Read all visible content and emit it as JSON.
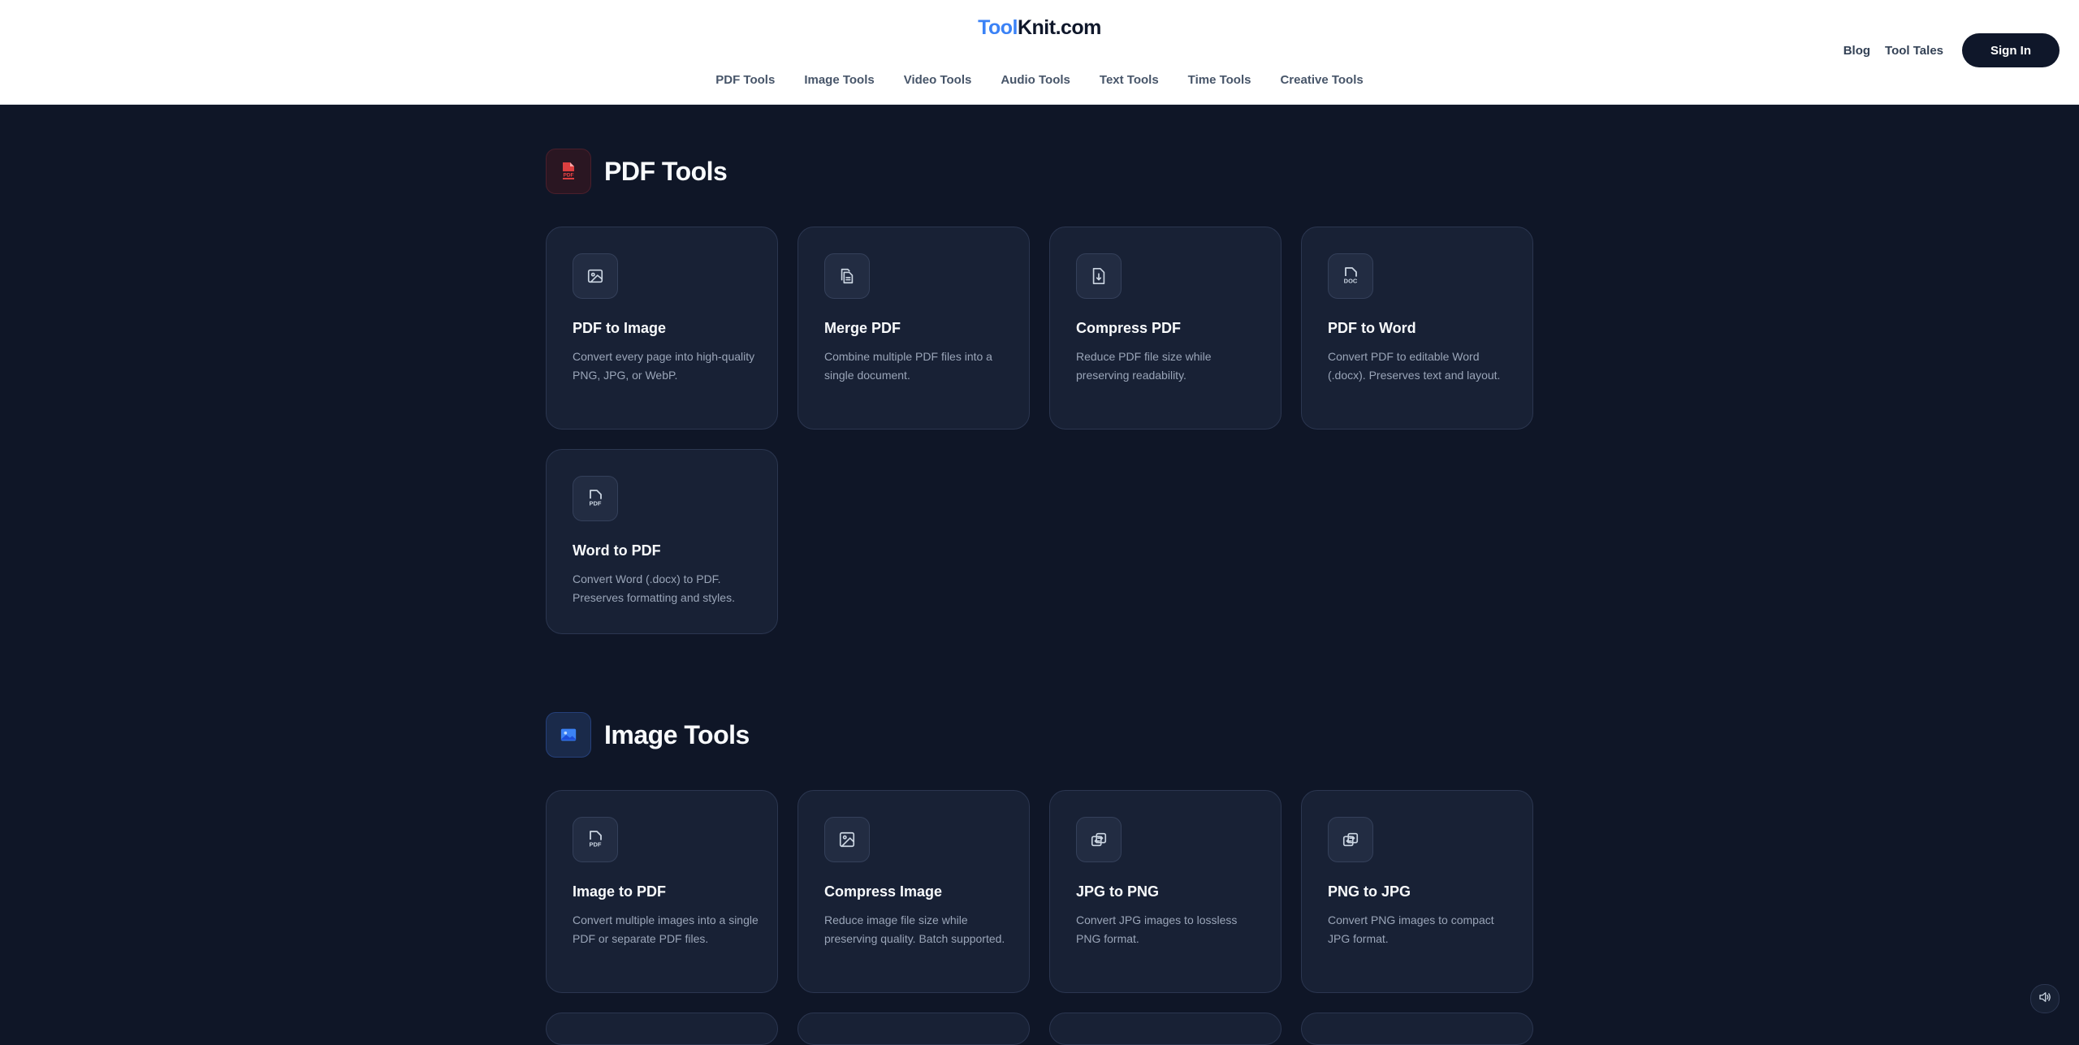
{
  "header": {
    "logo_part1": "Tool",
    "logo_part2": "Knit.com",
    "nav": [
      "PDF Tools",
      "Image Tools",
      "Video Tools",
      "Audio Tools",
      "Text Tools",
      "Time Tools",
      "Creative Tools"
    ],
    "blog": "Blog",
    "tool_tales": "Tool Tales",
    "sign_in": "Sign In"
  },
  "sections": [
    {
      "title": "PDF Tools",
      "icon": "pdf-file-icon",
      "accent": "#ef4444",
      "tools": [
        {
          "title": "PDF to Image",
          "desc": "Convert every page into high-quality PNG, JPG, or WebP.",
          "icon": "image-icon"
        },
        {
          "title": "Merge PDF",
          "desc": "Combine multiple PDF files into a single document.",
          "icon": "files-icon"
        },
        {
          "title": "Compress PDF",
          "desc": "Reduce PDF file size while preserving readability.",
          "icon": "compress-file-icon"
        },
        {
          "title": "PDF to Word",
          "desc": "Convert PDF to editable Word (.docx). Preserves text and layout.",
          "icon": "doc-file-icon"
        },
        {
          "title": "Word to PDF",
          "desc": "Convert Word (.docx) to PDF. Preserves formatting and styles.",
          "icon": "pdf-file-icon"
        }
      ]
    },
    {
      "title": "Image Tools",
      "icon": "image-icon",
      "accent": "#3b82f6",
      "tools": [
        {
          "title": "Image to PDF",
          "desc": "Convert multiple images into a single PDF or separate PDF files.",
          "icon": "pdf-file-icon"
        },
        {
          "title": "Compress Image",
          "desc": "Reduce image file size while preserving quality. Batch supported.",
          "icon": "image-icon"
        },
        {
          "title": "JPG to PNG",
          "desc": "Convert JPG images to lossless PNG format.",
          "icon": "convert-icon"
        },
        {
          "title": "PNG to JPG",
          "desc": "Convert PNG images to compact JPG format.",
          "icon": "convert-icon"
        }
      ]
    }
  ],
  "floating": {
    "icon": "speaker-icon"
  }
}
